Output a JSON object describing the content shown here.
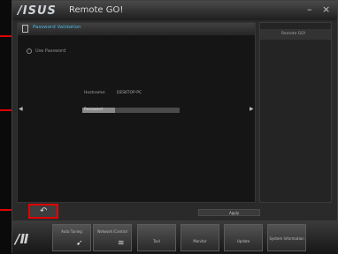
{
  "title_bar": {
    "logo": "/ISUS",
    "app_title": "Remote GO!",
    "minimize_label": "–",
    "close_label": "×"
  },
  "main_panel": {
    "header_title": "Password Validation",
    "option_label": "Use Password",
    "hostname_label": "Hostname:",
    "hostname_value": "DESKTOP-PC",
    "password_label": "Password",
    "password_fill_fraction": 0.34
  },
  "right_panel": {
    "title": "Remote GO!"
  },
  "apply_label": "Apply",
  "taskbar": {
    "logo": "/Ⅱ",
    "buttons": [
      {
        "label": "Auto Tuning"
      },
      {
        "label": "Network iControl"
      },
      {
        "label": "Tool"
      },
      {
        "label": "Monitor"
      },
      {
        "label": "Update"
      },
      {
        "label": "System Information"
      }
    ]
  }
}
